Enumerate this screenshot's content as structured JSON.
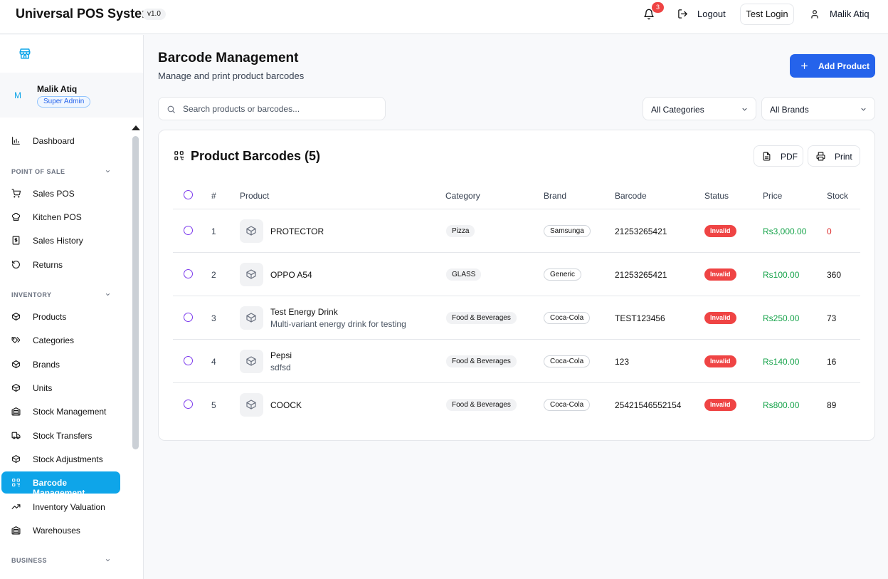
{
  "header": {
    "app_title": "Universal POS System",
    "version": "v1.0",
    "notification_count": "3",
    "logout_label": "Logout",
    "test_login_label": "Test Login",
    "user_name": "Malik Atiq"
  },
  "sidebar": {
    "user": {
      "initial": "M",
      "name": "Malik Atiq",
      "role": "Super Admin"
    },
    "items": [
      {
        "label": "Dashboard",
        "icon": "bar-chart-icon"
      },
      {
        "label": "Sales POS",
        "icon": "cart-icon"
      },
      {
        "label": "Kitchen POS",
        "icon": "chef-hat-icon"
      },
      {
        "label": "Sales History",
        "icon": "receipt-icon"
      },
      {
        "label": "Returns",
        "icon": "rotate-ccw-icon"
      },
      {
        "label": "Products",
        "icon": "package-icon"
      },
      {
        "label": "Categories",
        "icon": "tags-icon"
      },
      {
        "label": "Brands",
        "icon": "package-icon"
      },
      {
        "label": "Units",
        "icon": "package-icon"
      },
      {
        "label": "Stock Management",
        "icon": "warehouse-icon"
      },
      {
        "label": "Stock Transfers",
        "icon": "truck-icon"
      },
      {
        "label": "Stock Adjustments",
        "icon": "package-icon"
      },
      {
        "label": "Barcode Management",
        "icon": "qr-code-icon",
        "active": true
      },
      {
        "label": "Inventory Valuation",
        "icon": "trending-up-icon"
      },
      {
        "label": "Warehouses",
        "icon": "warehouse-icon"
      }
    ],
    "sections": {
      "point_of_sale": "POINT OF SALE",
      "inventory": "INVENTORY",
      "business": "BUSINESS"
    }
  },
  "page": {
    "title": "Barcode Management",
    "subtitle": "Manage and print product barcodes",
    "add_button": "Add Product",
    "search_placeholder": "Search products or barcodes...",
    "category_filter": "All Categories",
    "brand_filter": "All Brands"
  },
  "table": {
    "title": "Product Barcodes (5)",
    "pdf_label": "PDF",
    "print_label": "Print",
    "headers": {
      "index": "#",
      "product": "Product",
      "category": "Category",
      "brand": "Brand",
      "barcode": "Barcode",
      "status": "Status",
      "price": "Price",
      "stock": "Stock"
    },
    "rows": [
      {
        "index": "1",
        "name": "PROTECTOR",
        "description": "",
        "category": "Pizza",
        "brand": "Samsunga",
        "barcode": "21253265421",
        "status": "Invalid",
        "price": "Rs3,000.00",
        "stock": "0"
      },
      {
        "index": "2",
        "name": "OPPO A54",
        "description": "",
        "category": "GLASS",
        "brand": "Generic",
        "barcode": "21253265421",
        "status": "Invalid",
        "price": "Rs100.00",
        "stock": "360"
      },
      {
        "index": "3",
        "name": "Test Energy Drink",
        "description": "Multi-variant energy drink for testing",
        "category": "Food & Beverages",
        "brand": "Coca-Cola",
        "barcode": "TEST123456",
        "status": "Invalid",
        "price": "Rs250.00",
        "stock": "73"
      },
      {
        "index": "4",
        "name": "Pepsi",
        "description": "sdfsd",
        "category": "Food & Beverages",
        "brand": "Coca-Cola",
        "barcode": "123",
        "status": "Invalid",
        "price": "Rs140.00",
        "stock": "16"
      },
      {
        "index": "5",
        "name": "COOCK",
        "description": "",
        "category": "Food & Beverages",
        "brand": "Coca-Cola",
        "barcode": "25421546552154",
        "status": "Invalid",
        "price": "Rs800.00",
        "stock": "89"
      }
    ]
  },
  "colors": {
    "primary": "#2563eb",
    "sidebar_active": "#0ea5e9",
    "danger": "#ef4444",
    "price": "#16a34a"
  }
}
